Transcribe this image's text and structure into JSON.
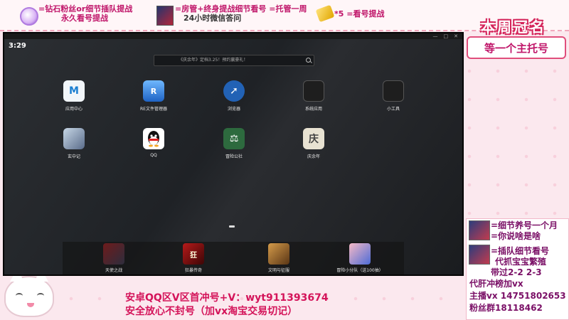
{
  "top_banner": {
    "diamond_line1": "=钻石粉丝or细节插队提战",
    "diamond_line2": "永久看号提战",
    "manager_line1": "=房管+终身提战细节看号 =托管一周",
    "manager_line2": "24小时微信答问",
    "five_line": "*5  =看号提战"
  },
  "side_panel": {
    "title": "本周冠名",
    "crown_text": "等一个主托号",
    "lines": [
      "=细节养号一个月",
      "=你说啥是啥",
      "=插队细节看号",
      "代抓宝宝繁殖",
      "带过2-2 2-3",
      "代肝冲榜加vx",
      "主播vx 14751802653",
      "粉丝群18118462"
    ]
  },
  "caption": {
    "line1": "安卓QQ区V区首冲号+V：wyt911393674",
    "line2": "安全放心不封号（加vx淘宝交易切记）"
  },
  "emulator": {
    "status_time": "3:29",
    "search_placeholder": "《庆余年》定档3.25！预约赢豪礼！",
    "apps_row1": [
      {
        "label": "应用中心",
        "icon": "app-store-icon"
      },
      {
        "label": "RE文件管理器",
        "icon": "re-file-manager-icon"
      },
      {
        "label": "浏览器",
        "icon": "browser-icon"
      },
      {
        "label": "系统应用",
        "icon": "system-apps-icon"
      },
      {
        "label": "小工具",
        "icon": "tools-icon"
      }
    ],
    "apps_row2": [
      {
        "label": "玄中记",
        "icon": "xuanzhongji-icon"
      },
      {
        "label": "QQ",
        "icon": "qq-icon"
      },
      {
        "label": "冒险公社",
        "icon": "adventure-guild-icon"
      },
      {
        "label": "庆余年",
        "icon": "qingyunian-icon"
      }
    ],
    "dock": [
      {
        "label": "天使之战",
        "icon": "angel-war-icon"
      },
      {
        "label": "狂暴传奇",
        "icon": "kuangbao-icon"
      },
      {
        "label": "文明与征服",
        "icon": "civilization-icon"
      },
      {
        "label": "冒险小分队（送100抽）",
        "icon": "adventure-team-icon"
      }
    ]
  }
}
